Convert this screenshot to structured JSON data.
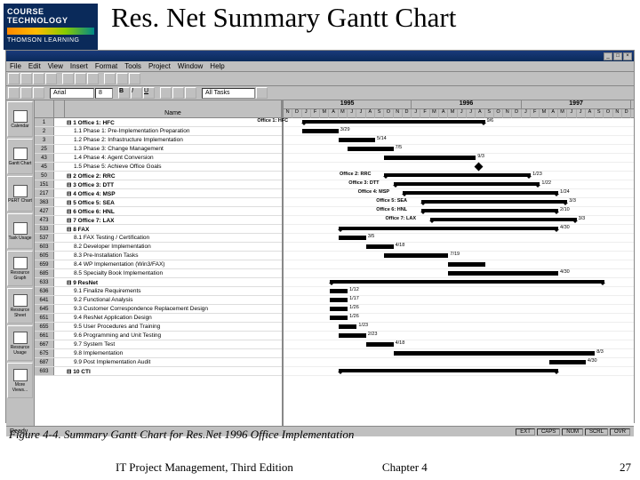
{
  "logo": {
    "top": "COURSE TECHNOLOGY",
    "bottom": "THOMSON LEARNING"
  },
  "title": "Res. Net Summary Gantt Chart",
  "menu": [
    "File",
    "Edit",
    "View",
    "Insert",
    "Format",
    "Tools",
    "Project",
    "Window",
    "Help"
  ],
  "toolbar2": {
    "font": "Arial",
    "size": "8",
    "filter": "All Tasks"
  },
  "sidebar": [
    "Calendar",
    "Gantt Chart",
    "PERT Chart",
    "Task Usage",
    "Resource Graph",
    "Resource Sheet",
    "Resource Usage",
    "More Views..."
  ],
  "columns": {
    "id": "",
    "ind": "",
    "name": "Name"
  },
  "timeline": {
    "years": [
      {
        "label": "1995",
        "months": [
          "N",
          "D",
          "J",
          "F",
          "M",
          "A",
          "M",
          "J",
          "J",
          "A",
          "S",
          "O",
          "N",
          "D"
        ]
      },
      {
        "label": "1996",
        "months": [
          "J",
          "F",
          "M",
          "A",
          "M",
          "J",
          "J",
          "A",
          "S",
          "O",
          "N",
          "D"
        ]
      },
      {
        "label": "1997",
        "months": [
          "J",
          "F",
          "M",
          "A",
          "M",
          "J",
          "J",
          "A",
          "S",
          "O",
          "N",
          "D"
        ]
      }
    ],
    "pre": 2
  },
  "tasks": [
    {
      "id": "1",
      "name": "1 Office 1: HFC",
      "sum": true,
      "start": 2,
      "len": 20,
      "label": "Office 1: HFC",
      "end_date": "9/6"
    },
    {
      "id": "2",
      "name": "1.1 Phase 1: Pre-Implementation Preparation",
      "sub": true,
      "start": 2,
      "len": 4,
      "date": "3/29"
    },
    {
      "id": "3",
      "name": "1.2 Phase 2: Infrastructure Implementation",
      "sub": true,
      "start": 6,
      "len": 4,
      "date": "5/14"
    },
    {
      "id": "25",
      "name": "1.3 Phase 3: Change Management",
      "sub": true,
      "start": 7,
      "len": 5,
      "date": "7/5"
    },
    {
      "id": "43",
      "name": "1.4 Phase 4: Agent Conversion",
      "sub": true,
      "start": 11,
      "len": 10,
      "date": "9/3"
    },
    {
      "id": "45",
      "name": "1.5 Phase 5: Achieve Office Goals",
      "sub": true,
      "ms": true,
      "start": 21,
      "date": ""
    },
    {
      "id": "50",
      "name": "2 Office 2: RRC",
      "sum": true,
      "start": 11,
      "len": 16,
      "label": "Office 2: RRC",
      "end_date": "1/23"
    },
    {
      "id": "151",
      "name": "3 Office 3: DTT",
      "sum": true,
      "start": 12,
      "len": 16,
      "label": "Office 3: DTT",
      "end_date": "1/22"
    },
    {
      "id": "217",
      "name": "4 Office 4: MSP",
      "sum": true,
      "start": 13,
      "len": 17,
      "label": "Office 4: MSP",
      "end_date": "1/24"
    },
    {
      "id": "363",
      "name": "5 Office 5: SEA",
      "sum": true,
      "start": 15,
      "len": 16,
      "label": "Office 5: SEA",
      "end_date": "3/3"
    },
    {
      "id": "427",
      "name": "6 Office 6: HNL",
      "sum": true,
      "start": 15,
      "len": 15,
      "label": "Office 6: HNL",
      "end_date": "2/10"
    },
    {
      "id": "473",
      "name": "7 Office 7: LAX",
      "sum": true,
      "start": 16,
      "len": 16,
      "label": "Office 7: LAX",
      "end_date": "3/3"
    },
    {
      "id": "533",
      "name": "8 FAX",
      "sum": true,
      "start": 6,
      "len": 24,
      "date": "4/30"
    },
    {
      "id": "537",
      "name": "8.1 FAX Testing / Certification",
      "sub": true,
      "start": 6,
      "len": 3,
      "date": "3/5"
    },
    {
      "id": "603",
      "name": "8.2 Developer Implementation",
      "sub": true,
      "start": 9,
      "len": 3,
      "date": "4/18"
    },
    {
      "id": "605",
      "name": "8.3 Pre-Installation Tasks",
      "sub": true,
      "start": 11,
      "len": 7,
      "date": "7/19"
    },
    {
      "id": "659",
      "name": "8.4 WP Implementation (Win3/FAX)",
      "sub": true,
      "start": 18,
      "len": 4,
      "date": ""
    },
    {
      "id": "685",
      "name": "8.5 Specialty Book Implementation",
      "sub": true,
      "start": 18,
      "len": 12,
      "date": "4/30"
    },
    {
      "id": "633",
      "name": "9 ResNet",
      "sum": true,
      "start": 5,
      "len": 30,
      "date": ""
    },
    {
      "id": "636",
      "name": "9.1 Finalize Requirements",
      "sub": true,
      "start": 5,
      "len": 2,
      "date": "1/12"
    },
    {
      "id": "641",
      "name": "9.2 Functional Analysis",
      "sub": true,
      "start": 5,
      "len": 2,
      "date": "1/17"
    },
    {
      "id": "645",
      "name": "9.3 Customer Correspondence Replacement Design",
      "sub": true,
      "start": 5,
      "len": 2,
      "date": "1/26"
    },
    {
      "id": "651",
      "name": "9.4 ResNet Application Design",
      "sub": true,
      "start": 5,
      "len": 2,
      "date": "1/26"
    },
    {
      "id": "655",
      "name": "9.5 User Procedures and Training",
      "sub": true,
      "start": 6,
      "len": 2,
      "date": "1/23"
    },
    {
      "id": "661",
      "name": "9.6 Programming and Unit Testing",
      "sub": true,
      "start": 6,
      "len": 3,
      "date": "2/23"
    },
    {
      "id": "667",
      "name": "9.7 System Test",
      "sub": true,
      "start": 9,
      "len": 3,
      "date": "4/18"
    },
    {
      "id": "675",
      "name": "9.8 Implementation",
      "sub": true,
      "start": 12,
      "len": 22,
      "date": "8/3"
    },
    {
      "id": "687",
      "name": "9.9 Post Implementation Audit",
      "sub": true,
      "start": 29,
      "len": 4,
      "date": "4/30"
    },
    {
      "id": "693",
      "name": "10 CTI",
      "sum": true,
      "start": 6,
      "len": 24,
      "date": ""
    }
  ],
  "status": {
    "ready": "Ready",
    "boxes": [
      "EXT",
      "CAPS",
      "NUM",
      "SCRL",
      "OVR"
    ]
  },
  "caption": "Figure 4-4. Summary Gantt Chart for Res.Net 1996 Office Implementation",
  "footer": {
    "book": "IT Project Management, Third Edition",
    "chapter": "Chapter 4",
    "page": "27"
  },
  "chart_data": {
    "type": "gantt",
    "title": "Res.Net Summary Gantt Chart",
    "time_axis": {
      "start": "1995-11",
      "end": "1997-12",
      "unit": "month"
    },
    "tasks": [
      {
        "id": 1,
        "name": "Office 1: HFC",
        "type": "summary",
        "start": "1995-12",
        "end": "1996-09",
        "finish_label": "9/6"
      },
      {
        "id": 2,
        "name": "Phase 1: Pre-Implementation Preparation",
        "parent": 1,
        "start": "1995-12",
        "end": "1996-03",
        "finish_label": "3/29"
      },
      {
        "id": 3,
        "name": "Phase 2: Infrastructure Implementation",
        "parent": 1,
        "start": "1996-03",
        "end": "1996-05",
        "finish_label": "5/14"
      },
      {
        "id": 25,
        "name": "Phase 3: Change Management",
        "parent": 1,
        "start": "1996-04",
        "end": "1996-07",
        "finish_label": "7/5"
      },
      {
        "id": 43,
        "name": "Phase 4: Agent Conversion",
        "parent": 1,
        "start": "1996-06",
        "end": "1996-09",
        "finish_label": "9/3"
      },
      {
        "id": 45,
        "name": "Phase 5: Achieve Office Goals",
        "parent": 1,
        "type": "milestone",
        "date": "1996-09"
      },
      {
        "id": 50,
        "name": "Office 2: RRC",
        "type": "summary",
        "start": "1996-06",
        "end": "1997-01",
        "finish_label": "1/23"
      },
      {
        "id": 151,
        "name": "Office 3: DTT",
        "type": "summary",
        "start": "1996-07",
        "end": "1997-01",
        "finish_label": "1/22"
      },
      {
        "id": 217,
        "name": "Office 4: MSP",
        "type": "summary",
        "start": "1996-08",
        "end": "1997-01",
        "finish_label": "1/24"
      },
      {
        "id": 363,
        "name": "Office 5: SEA",
        "type": "summary",
        "start": "1996-09",
        "end": "1997-03",
        "finish_label": "3/3"
      },
      {
        "id": 427,
        "name": "Office 6: HNL",
        "type": "summary",
        "start": "1996-09",
        "end": "1997-02",
        "finish_label": "2/10"
      },
      {
        "id": 473,
        "name": "Office 7: LAX",
        "type": "summary",
        "start": "1996-10",
        "end": "1997-03",
        "finish_label": "3/3"
      },
      {
        "id": 533,
        "name": "FAX",
        "type": "summary",
        "start": "1996-02",
        "end": "1997-04",
        "finish_label": "4/30"
      },
      {
        "id": 537,
        "name": "FAX Testing / Certification",
        "parent": 533,
        "start": "1996-02",
        "end": "1996-03",
        "finish_label": "3/5"
      },
      {
        "id": 603,
        "name": "Developer Implementation",
        "parent": 533,
        "start": "1996-03",
        "end": "1996-04",
        "finish_label": "4/18"
      },
      {
        "id": 605,
        "name": "Pre-Installation Tasks",
        "parent": 533,
        "start": "1996-05",
        "end": "1996-07",
        "finish_label": "7/19"
      },
      {
        "id": 659,
        "name": "WP Implementation (Win3/FAX)",
        "parent": 533,
        "start": "1996-10",
        "end": "1997-01"
      },
      {
        "id": 685,
        "name": "Specialty Book Implementation",
        "parent": 533,
        "start": "1996-10",
        "end": "1997-04",
        "finish_label": "4/30"
      },
      {
        "id": 633,
        "name": "ResNet",
        "type": "summary",
        "start": "1996-01",
        "end": "1997-08"
      },
      {
        "id": 636,
        "name": "Finalize Requirements",
        "parent": 633,
        "start": "1996-01",
        "end": "1996-01",
        "finish_label": "1/12"
      },
      {
        "id": 641,
        "name": "Functional Analysis",
        "parent": 633,
        "start": "1996-01",
        "end": "1996-01",
        "finish_label": "1/17"
      },
      {
        "id": 645,
        "name": "Customer Correspondence Replacement Design",
        "parent": 633,
        "start": "1996-01",
        "end": "1996-01",
        "finish_label": "1/26"
      },
      {
        "id": 651,
        "name": "ResNet Application Design",
        "parent": 633,
        "start": "1996-01",
        "end": "1996-01",
        "finish_label": "1/26"
      },
      {
        "id": 655,
        "name": "User Procedures and Training",
        "parent": 633,
        "start": "1996-01",
        "end": "1996-01",
        "finish_label": "1/23"
      },
      {
        "id": 661,
        "name": "Programming and Unit Testing",
        "parent": 633,
        "start": "1996-01",
        "end": "1996-02",
        "finish_label": "2/23"
      },
      {
        "id": 667,
        "name": "System Test",
        "parent": 633,
        "start": "1996-03",
        "end": "1996-04",
        "finish_label": "4/18"
      },
      {
        "id": 675,
        "name": "Implementation",
        "parent": 633,
        "start": "1996-06",
        "end": "1997-08",
        "finish_label": "8/3"
      },
      {
        "id": 687,
        "name": "Post Implementation Audit",
        "parent": 633,
        "start": "1997-04",
        "end": "1997-04",
        "finish_label": "4/30"
      },
      {
        "id": 693,
        "name": "CTI",
        "type": "summary",
        "start": "1996-02",
        "end": "1997-06"
      }
    ]
  }
}
